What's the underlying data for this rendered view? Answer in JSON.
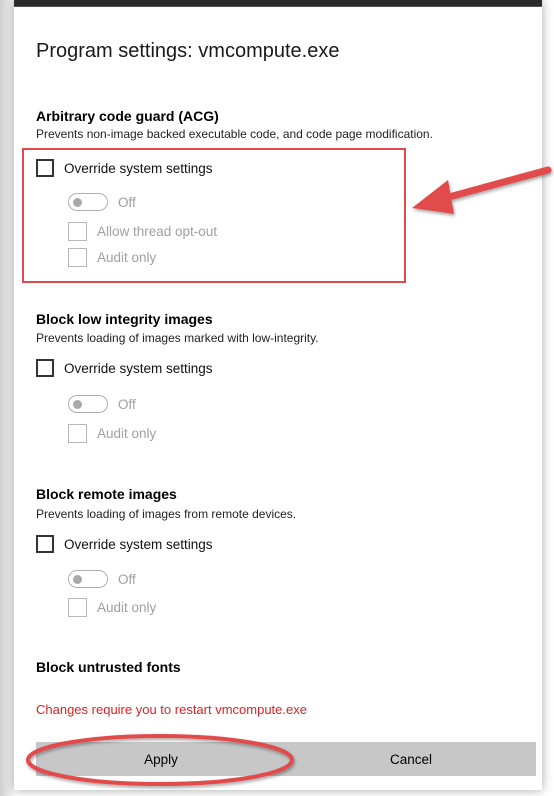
{
  "dialog": {
    "title": "Program settings: vmcompute.exe"
  },
  "sections": [
    {
      "title": "Arbitrary code guard (ACG)",
      "description": "Prevents non-image backed executable code, and code page modification.",
      "override_label": "Override system settings",
      "override_checked": false,
      "toggle_label": "Off",
      "toggle_on": false,
      "options": [
        "Allow thread opt-out",
        "Audit only"
      ]
    },
    {
      "title": "Block low integrity images",
      "description": "Prevents loading of images marked with low-integrity.",
      "override_label": "Override system settings",
      "override_checked": false,
      "toggle_label": "Off",
      "toggle_on": false,
      "options": [
        "Audit only"
      ]
    },
    {
      "title": "Block remote images",
      "description": "Prevents loading of images from remote devices.",
      "override_label": "Override system settings",
      "override_checked": false,
      "toggle_label": "Off",
      "toggle_on": false,
      "options": [
        "Audit only"
      ]
    },
    {
      "title": "Block untrusted fonts"
    }
  ],
  "footer": {
    "restart_warning": "Changes require you to restart vmcompute.exe",
    "apply_label": "Apply",
    "cancel_label": "Cancel"
  },
  "colors": {
    "annotation": "#e24b4b",
    "warning": "#e02020",
    "button_bar": "#c7c7c7"
  }
}
